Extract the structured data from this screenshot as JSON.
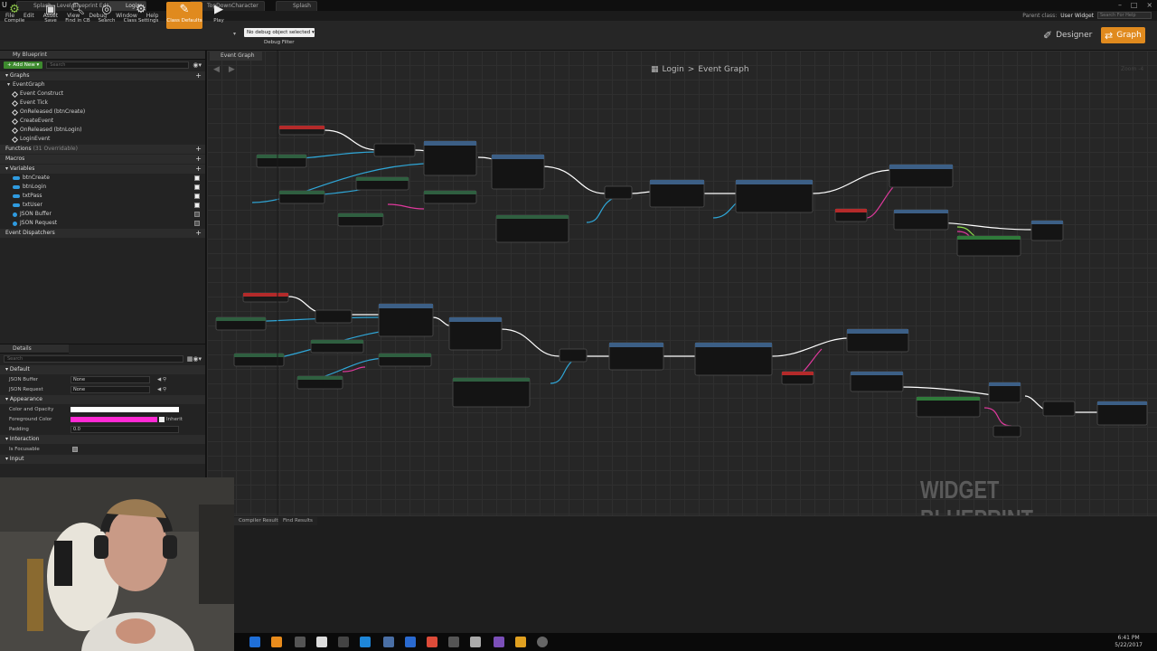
{
  "window": {
    "tabs": [
      "Splash - Level Blueprint Editor",
      "Login",
      "TopDownCharacter",
      "Splash"
    ],
    "parent_class_label": "Parent class:",
    "parent_class_value": "User Widget",
    "help_search_placeholder": "Search For Help"
  },
  "menu": [
    "File",
    "Edit",
    "Asset",
    "View",
    "Debug",
    "Window",
    "Help"
  ],
  "toolbar": {
    "compile": "Compile",
    "save": "Save",
    "find_in_cb": "Find in CB",
    "search": "Search",
    "class_settings": "Class Settings",
    "class_defaults": "Class Defaults",
    "play": "Play",
    "debug_selector": "No debug object selected ▾",
    "debug_filter": "Debug Filter",
    "designer": "Designer",
    "graph": "Graph"
  },
  "my_blueprint": {
    "title": "My Blueprint",
    "add_new": "+ Add New ▾",
    "search_placeholder": "Search",
    "graphs_header": "Graphs",
    "event_graph": "EventGraph",
    "events": [
      "Event Construct",
      "Event Tick",
      "OnReleased (btnCreate)",
      "CreateEvent",
      "OnReleased (btnLogin)",
      "LoginEvent"
    ],
    "functions_header": "Functions",
    "functions_note": "(31 Overridable)",
    "macros_header": "Macros",
    "variables_header": "Variables",
    "variables": [
      {
        "name": "btnCreate",
        "color": "#2f9be0"
      },
      {
        "name": "btnLogin",
        "color": "#2f9be0"
      },
      {
        "name": "txtPass",
        "color": "#2f9be0"
      },
      {
        "name": "txtUser",
        "color": "#2f9be0"
      },
      {
        "name": "JSON Buffer",
        "color": "#2f9be0"
      },
      {
        "name": "JSON Request",
        "color": "#2f9be0"
      }
    ],
    "dispatchers_header": "Event Dispatchers"
  },
  "details": {
    "title": "Details",
    "search_placeholder": "Search",
    "default_header": "Default",
    "json_buffer_label": "JSON Buffer",
    "json_buffer_value": "None",
    "json_request_label": "JSON Request",
    "json_request_value": "None",
    "appearance_header": "Appearance",
    "color_opacity_label": "Color and Opacity",
    "foreground_label": "Foreground Color",
    "foreground_tag": "Inherit",
    "padding_label": "Padding",
    "padding_value": "0.0",
    "interaction_header": "Interaction",
    "focusable_label": "Is Focusable",
    "input_header": "Input"
  },
  "graph": {
    "tab": "Event Graph",
    "breadcrumb_root": "Login",
    "breadcrumb_sep": ">",
    "breadcrumb_leaf": "Event Graph",
    "zoom": "Zoom -4",
    "watermark": "WIDGET BLUEPRINT"
  },
  "results": {
    "tab1": "Compiler Results",
    "tab2": "Find Results"
  },
  "taskbar": {
    "time": "6:41 PM",
    "date": "5/22/2017"
  },
  "colors": {
    "accent": "#e08a1e",
    "exec_wire": "#ffffff",
    "object_wire": "#2fa7d8",
    "string_wire": "#e0399d",
    "event_header": "#b42a2a"
  }
}
